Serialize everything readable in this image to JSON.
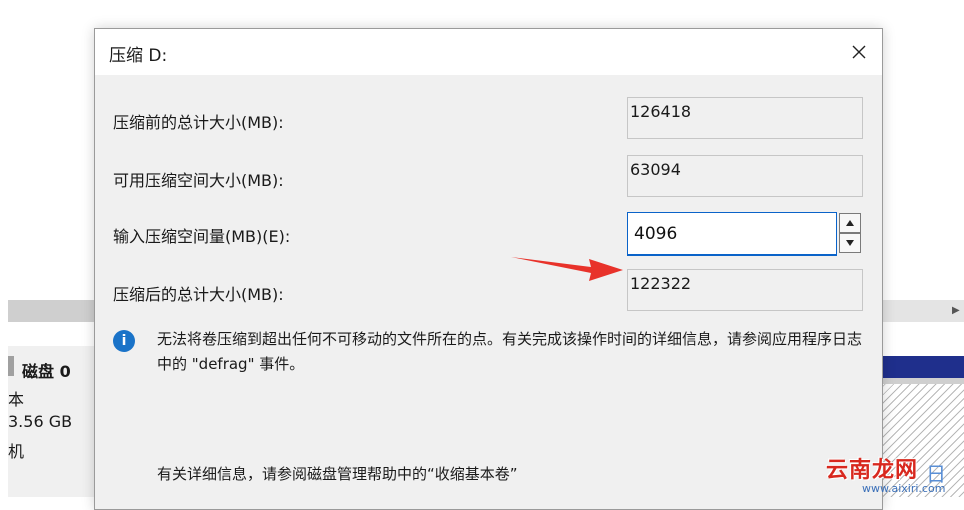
{
  "background": {
    "disk_label": "磁盘 0",
    "disk_lines": [
      "本",
      "3.56 GB",
      "机"
    ]
  },
  "dialog": {
    "title": "压缩 D:",
    "rows": [
      {
        "label": "压缩前的总计大小(MB):",
        "value": "126418"
      },
      {
        "label": "可用压缩空间大小(MB):",
        "value": "63094"
      },
      {
        "label": "输入压缩空间量(MB)(E):",
        "value": "4096"
      },
      {
        "label": "压缩后的总计大小(MB):",
        "value": "122322"
      }
    ],
    "info_text": "无法将卷压缩到超出任何不可移动的文件所在的点。有关完成该操作时间的详细信息，请参阅应用程序日志中的 \"defrag\" 事件。",
    "help_text": "有关详细信息，请参阅磁盘管理帮助中的“收缩基本卷”"
  },
  "watermark": {
    "brand": "云南龙网",
    "suffix": "日",
    "url": "www.aixiri.com"
  },
  "colors": {
    "accent": "#0a63c9",
    "arrow": "#e8322a",
    "info": "#1a73c8",
    "watermark_red": "#d8281e"
  },
  "icons": {
    "close": "close-icon",
    "info": "info-icon",
    "spin_up": "chevron-up-icon",
    "spin_down": "chevron-down-icon"
  }
}
